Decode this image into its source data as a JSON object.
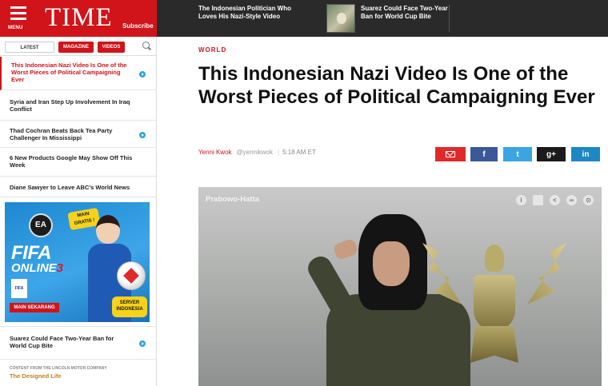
{
  "header": {
    "menu_label": "MENU",
    "logo": "TIME",
    "subscribe": "Subscribe",
    "top_stories": [
      {
        "title": "The Indonesian Politician Who Loves His Nazi-Style Video"
      },
      {
        "title": "Suarez Could Face Two-Year Ban for World Cup Bite"
      }
    ],
    "brand_color": "#d0141a"
  },
  "sidebar": {
    "tabs": [
      {
        "label": "LATEST",
        "active": true
      },
      {
        "label": "MAGAZINE"
      },
      {
        "label": "VIDEOS"
      }
    ],
    "items": [
      {
        "title": "This Indonesian Nazi Video Is One of the Worst Pieces of Political Campaigning Ever",
        "has_video": true,
        "active": true
      },
      {
        "title": "Syria and Iran Step Up Involvement In Iraq Conflict",
        "has_video": false
      },
      {
        "title": "Thad Cochran Beats Back Tea Party Challenger In Mississippi",
        "has_video": true
      },
      {
        "title": "6 New Products Google May Show Off This Week",
        "has_video": false
      },
      {
        "title": "Diane Sawyer to Leave ABC's World News",
        "has_video": false
      },
      {
        "title": "Suarez Could Face Two-Year Ban for World Cup Bite",
        "has_video": true
      }
    ],
    "ad": {
      "ea": "EA",
      "badge": "MAIN GRATIS !",
      "fifa": "FIFA",
      "online": "ONLINE",
      "online_num": "3",
      "fifa_logo": "FIFA",
      "button": "MAIN SEKARANG",
      "server": "SERVER INDONESIA"
    },
    "sponsored_label": "CONTENT FROM THE LINCOLN MOTOR COMPANY",
    "sponsored_title": "The Designed Life"
  },
  "article": {
    "section": "WORLD",
    "headline": "This Indonesian Nazi Video Is One of the Worst Pieces of Political Campaigning Ever",
    "author": "Yenni Kwok",
    "handle": "@yennikwok",
    "time": "5:18 AM ET",
    "share": {
      "facebook": "f",
      "twitter": "t",
      "googleplus": "g+",
      "linkedin": "in"
    },
    "video": {
      "title": "Prabowo-Hatta",
      "info_glyph": "i",
      "share_glyph": "<",
      "link_glyph": "∞",
      "embed_glyph": "⊙"
    }
  }
}
